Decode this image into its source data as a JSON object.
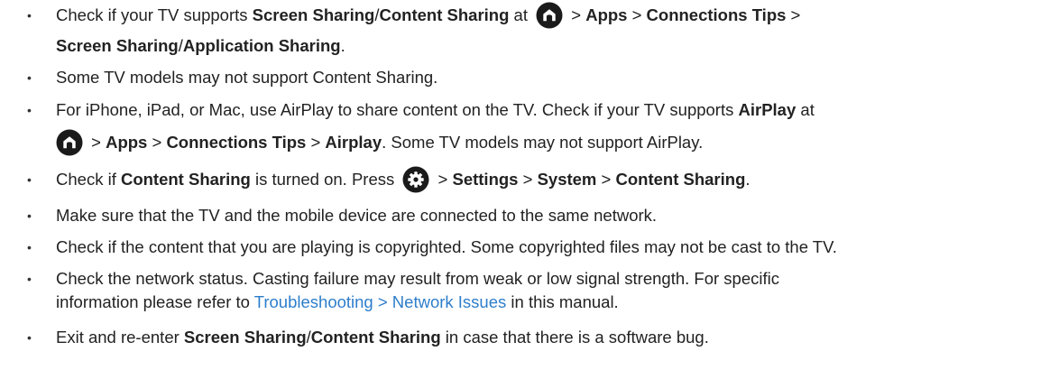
{
  "bullets": [
    {
      "parts": [
        {
          "t": "Check if your TV supports "
        },
        {
          "t": "Screen Sharing",
          "b": true
        },
        {
          "t": "/"
        },
        {
          "t": "Content Sharing",
          "b": true
        },
        {
          "t": " at "
        },
        {
          "icon": "home-icon"
        },
        {
          "t": " > "
        },
        {
          "t": "Apps",
          "b": true
        },
        {
          "t": " > "
        },
        {
          "t": "Connections Tips",
          "b": true
        },
        {
          "t": " >"
        },
        {
          "br": true
        },
        {
          "t": "Screen Sharing",
          "b": true
        },
        {
          "t": "/"
        },
        {
          "t": "Application Sharing",
          "b": true
        },
        {
          "t": "."
        }
      ]
    },
    {
      "parts": [
        {
          "t": "Some TV models may not support Content Sharing."
        }
      ]
    },
    {
      "parts": [
        {
          "t": "For iPhone, iPad, or Mac, use AirPlay to share content on the TV. Check if your TV supports "
        },
        {
          "t": "AirPlay",
          "b": true
        },
        {
          "t": " at"
        },
        {
          "br": true
        },
        {
          "icon": "home-icon",
          "lead": true
        },
        {
          "t": " > "
        },
        {
          "t": "Apps",
          "b": true
        },
        {
          "t": " > "
        },
        {
          "t": "Connections Tips",
          "b": true
        },
        {
          "t": " > "
        },
        {
          "t": "Airplay",
          "b": true
        },
        {
          "t": ". Some TV models may not support AirPlay."
        }
      ]
    },
    {
      "parts": [
        {
          "t": "Check if "
        },
        {
          "t": "Content Sharing",
          "b": true
        },
        {
          "t": " is turned on. Press "
        },
        {
          "icon": "settings-icon"
        },
        {
          "t": " > "
        },
        {
          "t": "Settings",
          "b": true
        },
        {
          "t": " > "
        },
        {
          "t": "System",
          "b": true
        },
        {
          "t": " > "
        },
        {
          "t": "Content Sharing",
          "b": true
        },
        {
          "t": "."
        }
      ]
    },
    {
      "parts": [
        {
          "t": "Make sure that the TV and the mobile device are connected to the same network."
        }
      ]
    },
    {
      "parts": [
        {
          "t": "Check if the content that you are playing is copyrighted. Some copyrighted files may not be cast to the TV."
        }
      ]
    },
    {
      "parts": [
        {
          "t": "Check the network status. Casting failure may result from weak or low signal strength. For specific"
        },
        {
          "br": true
        },
        {
          "t": "information please refer to "
        },
        {
          "t": "Troubleshooting > Network Issues",
          "link": true
        },
        {
          "t": " in this manual."
        }
      ]
    },
    {
      "parts": [
        {
          "t": "Exit and re-enter "
        },
        {
          "t": "Screen Sharing",
          "b": true
        },
        {
          "t": "/"
        },
        {
          "t": "Content Sharing",
          "b": true
        },
        {
          "t": " in case that there is a software bug."
        }
      ]
    }
  ]
}
